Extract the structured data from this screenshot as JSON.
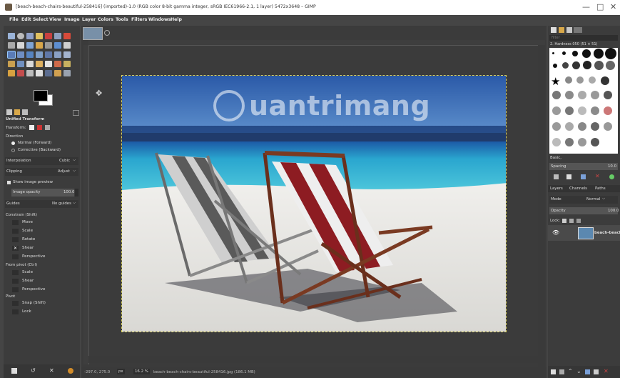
{
  "window": {
    "title": "[beach-beach-chairs-beautiful-258416] (imported)-1.0 (RGB color 8-bit gamma integer, sRGB IEC61966-2.1, 1 layer) 5472x3648 – GIMP",
    "controls": [
      "—",
      "□",
      "✕"
    ]
  },
  "menu": [
    "File",
    "Edit",
    "Select",
    "View",
    "Image",
    "Layer",
    "Colors",
    "Tools",
    "Filters",
    "Windows",
    "Help"
  ],
  "tool_options": {
    "heading": "Unified Transform",
    "transform_label": "Transform:",
    "direction_label": "Direction",
    "direction_options": [
      "Normal (Forward)",
      "Corrective (Backward)"
    ],
    "interpolation_label": "Interpolation",
    "interpolation_value": "Cubic",
    "clipping_label": "Clipping",
    "clipping_value": "Adjust",
    "show_preview_label": "Show image preview",
    "opacity_label": "Image opacity",
    "opacity_value": "100.0",
    "guides_label": "Guides",
    "guides_value": "No guides",
    "constrain_label": "Constrain (Shift)",
    "constrain_items": [
      "Move",
      "Scale",
      "Rotate",
      "Shear",
      "Perspective"
    ],
    "pivot_label": "From pivot (Ctrl)",
    "pivot_items": [
      "Scale",
      "Shear",
      "Perspective"
    ],
    "pivot2_label": "Pivot",
    "pivot2_items": [
      "Snap (Shift)",
      "Lock"
    ]
  },
  "watermark": "uantrimang",
  "status": {
    "coords": "-297.0, 275.0",
    "unit": "px",
    "zoom": "16.2 %",
    "filename": "beach-beach-chairs-beautiful-258416.jpg (186.1 MB)"
  },
  "brushes": {
    "filter_placeholder": "filter",
    "current": "2. Hardness 050 (51 × 51)",
    "preset": "Basic,",
    "spacing_label": "Spacing",
    "spacing_value": "10.0"
  },
  "layers": {
    "tabs": [
      "Layers",
      "Channels",
      "Paths"
    ],
    "mode_label": "Mode",
    "mode_value": "Normal",
    "opacity_label": "Opacity",
    "opacity_value": "100.0",
    "lock_label": "Lock:",
    "layer_name": "beach-beach"
  },
  "colors": {
    "bg": "#454545",
    "panel": "#3c3c3c",
    "selected": "#5a7cb8",
    "sky_top": "#2f62b1",
    "sea": "#3fb6d0",
    "sand": "#e5e5e2"
  }
}
